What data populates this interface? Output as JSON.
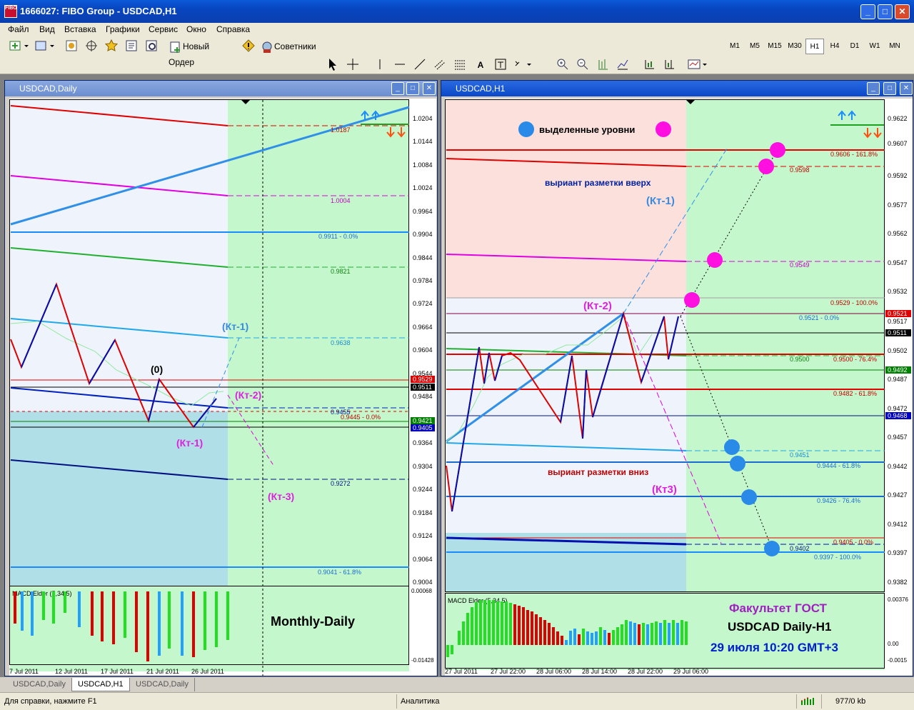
{
  "window": {
    "title": "1666027: FIBO Group - USDCAD,H1",
    "app_icon": "FIBO"
  },
  "menu": [
    "Файл",
    "Вид",
    "Вставка",
    "Графики",
    "Сервис",
    "Окно",
    "Справка"
  ],
  "toolbar": {
    "new_order": "Новый Ордер",
    "experts": "Советники"
  },
  "timeframes": [
    "M1",
    "M5",
    "M15",
    "M30",
    "H1",
    "H4",
    "D1",
    "W1",
    "MN"
  ],
  "active_timeframe": "H1",
  "left_chart": {
    "title": "USDCAD,Daily",
    "price_ticks": [
      "1.0204",
      "1.0144",
      "1.0084",
      "1.0024",
      "0.9964",
      "0.9904",
      "0.9844",
      "0.9784",
      "0.9724",
      "0.9664",
      "0.9604",
      "0.9544",
      "0.9484",
      "0.9424",
      "0.9364",
      "0.9304",
      "0.9244",
      "0.9184",
      "0.9124",
      "0.9064",
      "0.9004"
    ],
    "level_labels": [
      "1.0187",
      "1.0004",
      "0.9911 - 0.0%",
      "0.9821",
      "0.9638",
      "0.9455",
      "0.9445 - 0.0%",
      "0.9272",
      "0.9041 - 61.8%"
    ],
    "price_tags": [
      "0.9529",
      "0.9511",
      "0.9421",
      "0.9405"
    ],
    "annotations": [
      "(Кт-1)",
      "(Кт-2)",
      "(Кт-1)",
      "(Кт-3)",
      "(0)"
    ],
    "macd_label": "MACD Elder (5,34,5)",
    "macd_ticks": [
      "0.00068",
      "-0.01428"
    ],
    "overlay_text": "Monthly-Daily",
    "date_labels": [
      "7 Jul 2011",
      "12 Jul 2011",
      "17 Jul 2011",
      "21 Jul 2011",
      "26 Jul 2011"
    ]
  },
  "right_chart": {
    "title": "USDCAD,H1",
    "legend_text": "выделенные уровни",
    "variant_up": "выриант разметки вверх",
    "variant_down": "выриант разметки вниз",
    "price_ticks": [
      "0.9622",
      "0.9607",
      "0.9592",
      "0.9577",
      "0.9562",
      "0.9547",
      "0.9532",
      "0.9517",
      "0.9502",
      "0.9487",
      "0.9472",
      "0.9457",
      "0.9442",
      "0.9427",
      "0.9412",
      "0.9397",
      "0.9382"
    ],
    "level_labels": [
      "0.9606 - 161.8%",
      "0.9598",
      "0.9549",
      "0.9529 - 100.0%",
      "0.9521 - 0.0%",
      "0.9500",
      "0.9500 - 76.4%",
      "0.9482 - 61.8%",
      "0.9451",
      "0.9444 - 61.8%",
      "0.9426 - 76.4%",
      "0.9405 - 0.0%",
      "0.9402",
      "0.9397 - 100.0%"
    ],
    "price_tags": [
      "0.9521",
      "0.9511",
      "0.9492",
      "0.9468"
    ],
    "annotations": [
      "(Кт-1)",
      "(Кт-2)",
      "(Кт3)"
    ],
    "macd_label": "MACD Elder (5,34,5)",
    "macd_ticks": [
      "0.00376",
      "0.00",
      "-0.0015"
    ],
    "overlay_line1": "Факультет ГОСТ",
    "overlay_line2": "USDCAD Daily-H1",
    "overlay_line3": "29 июля 10:20 GMT+3",
    "date_labels": [
      "27 Jul 2011",
      "27 Jul 22:00",
      "28 Jul 06:00",
      "28 Jul 14:00",
      "28 Jul 22:00",
      "29 Jul 06:00"
    ]
  },
  "tabs": [
    "USDCAD,Daily",
    "USDCAD,H1",
    "USDCAD,Daily"
  ],
  "active_tab": 1,
  "status": {
    "help": "Для справки, нажмите F1",
    "profile": "Аналитика",
    "traffic": "977/0 kb"
  }
}
